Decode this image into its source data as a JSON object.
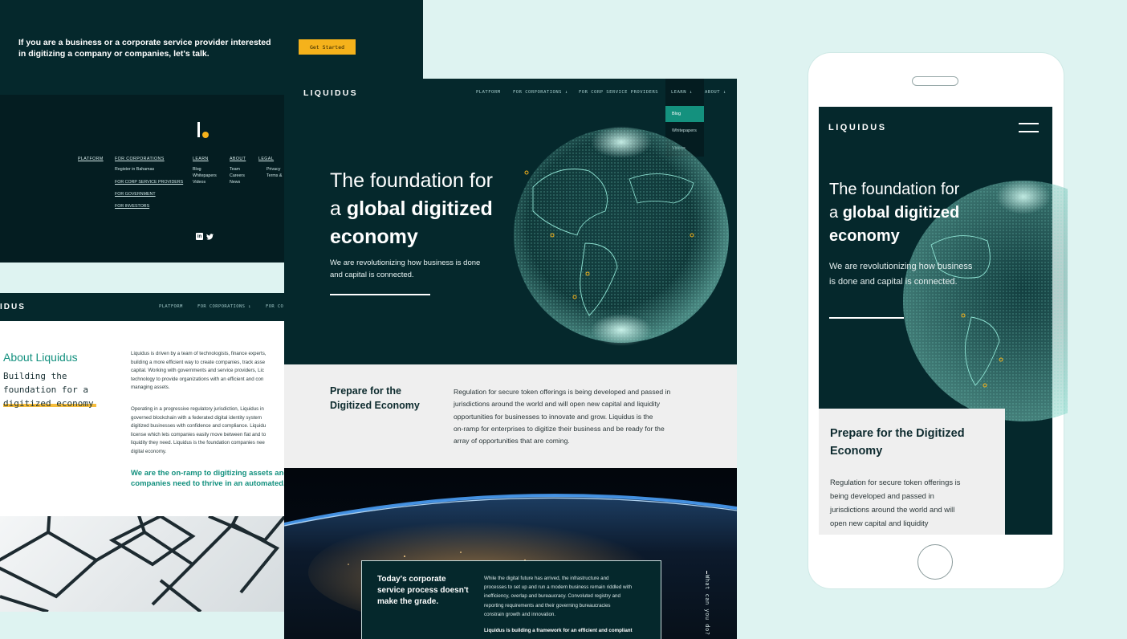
{
  "cta": {
    "text": "If you are a business or a corporate service provider interested in digitizing a company or companies, let's talk.",
    "button_label": "Get Started",
    "accent": "#f5b21b"
  },
  "footer": {
    "columns": [
      {
        "heading": "PLATFORM",
        "items": []
      },
      {
        "heading": "FOR CORPORATIONS",
        "items": [
          "Register in Bahamas"
        ],
        "links": [
          "FOR CORP SERVICE PROVIDERS",
          "FOR GOVERNMENT",
          "FOR INVESTORS"
        ]
      },
      {
        "heading": "LEARN",
        "items": [
          "Blog",
          "Whitepapers",
          "Videos"
        ]
      },
      {
        "heading": "ABOUT",
        "items": [
          "Team",
          "Careers",
          "News"
        ]
      },
      {
        "heading": "LEGAL",
        "items": [
          "Privacy",
          "Terms &"
        ]
      }
    ],
    "social": [
      "linkedin-icon",
      "twitter-icon"
    ]
  },
  "about_page": {
    "logo": "IDUS",
    "nav": [
      "PLATFORM",
      "FOR CORPORATIONS ↓",
      "FOR CO"
    ],
    "title": "About Liquidus",
    "subtitle": "Building the foundation for a digitized economy",
    "paragraph1": [
      "Liquidus is driven by a team of technologists, finance experts,",
      "building a more efficient way to create companies, track asse",
      "capital.  Working with governments and service providers, Lic",
      "technology to provide organizations with an efficient and con",
      "managing assets."
    ],
    "paragraph2": [
      "Operating in a progressive regulatory jurisdiction, Liquidus in",
      "governed blockchain with a federated digital identity system",
      "digitized businesses with confidence and compliance. Liquidu",
      "license which lets companies easily move between fiat and to",
      "liquidity they need. Liquidus is the foundation companies nee",
      "digital economy."
    ],
    "quote": [
      "We are the on-ramp to digitizing assets and",
      "companies need to thrive in an automated,"
    ]
  },
  "desktop": {
    "logo": "LIQUIDUS",
    "nav": {
      "platform": "PLATFORM",
      "corporations": "FOR CORPORATIONS ↓",
      "corp_service": "FOR CORP SERVICE PROVIDERS",
      "learn": "LEARN ↓",
      "about": "ABOUT ↓"
    },
    "dropdown": [
      "Blog",
      "Whitepapers",
      "Videos"
    ],
    "hero": {
      "line1": "The foundation for",
      "line2_prefix": "a ",
      "line2_bold": "global digitized",
      "line3_bold": "economy",
      "text": "We are revolutionizing how business is done and capital is connected."
    },
    "prepare": {
      "title": "Prepare for the Digitized Economy",
      "text": [
        "Regulation for secure token offerings is being developed and passed in",
        "jurisdictions around the world and will open new capital and liquidity",
        "opportunities for businesses to innovate and grow. Liquidus is the",
        "on-ramp for enterprises to digitize their business and be ready for the",
        "array of opportunities that are coming."
      ]
    },
    "today": {
      "title": "Today's corporate service process doesn't make the grade.",
      "text": [
        "While the digital future has arrived, the infrastructure and",
        "processes to set up and run a modern business remain riddled with",
        "inefficiency, overlap and bureaucracy. Convoluted registry and",
        "reporting requirements and their governing bureaucracies",
        "constrain growth and innovation."
      ],
      "bold": "Liquidus is building a framework for an efficient and compliant",
      "vertical": "What can you do?"
    }
  },
  "mobile": {
    "logo": "LIQUIDUS",
    "hero": {
      "line1": "The foundation for",
      "line2_prefix": "a ",
      "line2_bold": "global digitized",
      "line3_bold": "economy",
      "text": "We are revolutionizing how business is done and capital is connected."
    },
    "card": {
      "title": "Prepare for the Digitized Economy",
      "text": [
        "Regulation for secure token offerings is",
        "being developed and passed in",
        "jurisdictions around the world and will",
        "open new capital and liquidity"
      ]
    }
  }
}
